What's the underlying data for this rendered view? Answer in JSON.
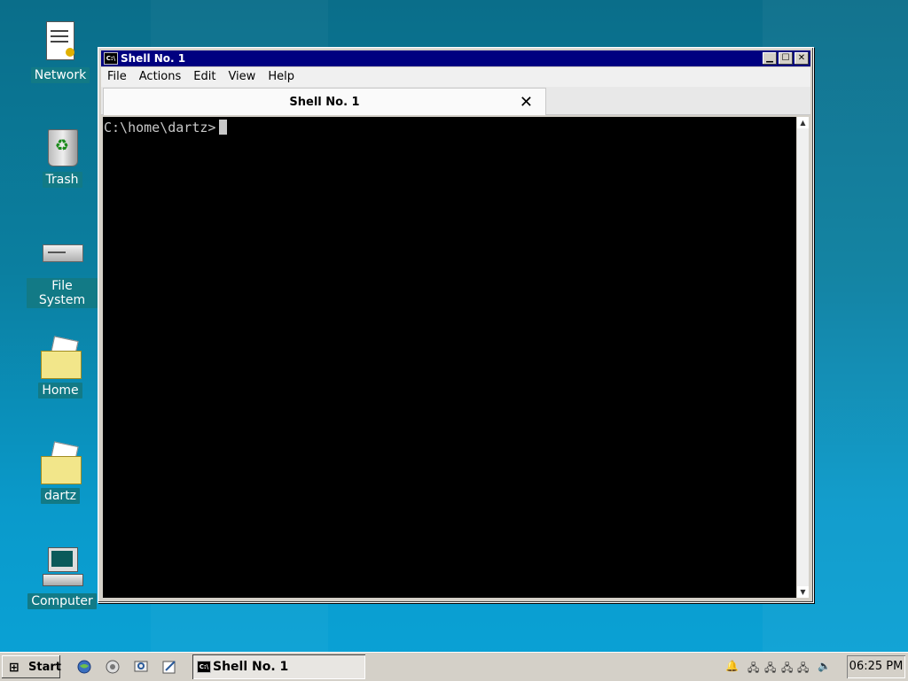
{
  "desktop": {
    "icons": [
      {
        "label": "Network"
      },
      {
        "label": "Trash"
      },
      {
        "label": "File System"
      },
      {
        "label": "Home"
      },
      {
        "label": "dartz"
      },
      {
        "label": "Computer"
      }
    ]
  },
  "window": {
    "title": "Shell No. 1",
    "menu": [
      "File",
      "Actions",
      "Edit",
      "View",
      "Help"
    ],
    "tab_label": "Shell No. 1",
    "tab_close": "✕",
    "prompt": "C:\\home\\dartz>"
  },
  "taskbar": {
    "start_label": "Start",
    "task_label": "Shell No. 1",
    "clock": "06:25 PM"
  }
}
